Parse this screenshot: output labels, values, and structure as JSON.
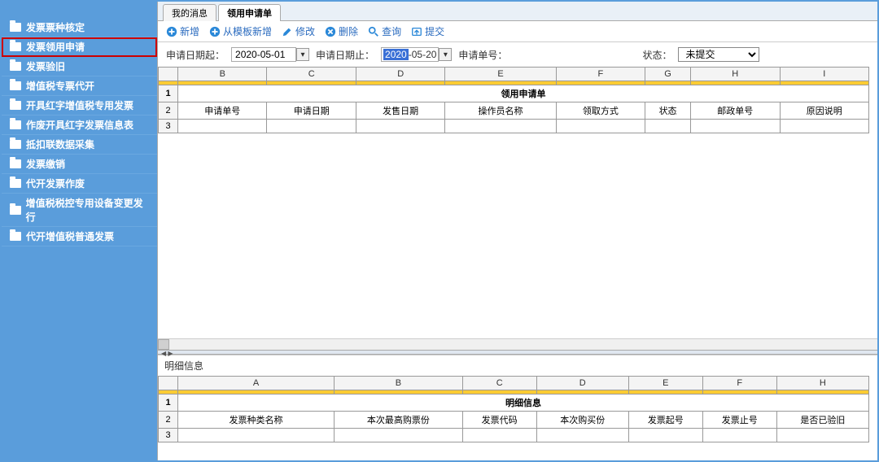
{
  "sidebar": {
    "items": [
      {
        "label": "发票票种核定"
      },
      {
        "label": "发票领用申请",
        "highlighted": true
      },
      {
        "label": "发票验旧"
      },
      {
        "label": "增值税专票代开"
      },
      {
        "label": "开具红字增值税专用发票"
      },
      {
        "label": "作废开具红字发票信息表"
      },
      {
        "label": "抵扣联数据采集"
      },
      {
        "label": "发票缴销"
      },
      {
        "label": "代开发票作废"
      },
      {
        "label": "增值税税控专用设备变更发行"
      },
      {
        "label": "代开增值税普通发票"
      }
    ]
  },
  "tabs": [
    {
      "label": "我的消息",
      "active": false
    },
    {
      "label": "领用申请单",
      "active": true
    }
  ],
  "toolbar": {
    "new": "新增",
    "newFromTpl": "从模板新增",
    "modify": "修改",
    "delete": "删除",
    "query": "查询",
    "submit": "提交"
  },
  "filters": {
    "dateFromLabel": "申请日期起：",
    "dateFrom": "2020-05-01",
    "dateToLabel": "申请日期止：",
    "dateToPrefix": "2020",
    "dateToSuffix": "-05-20",
    "orderLabel": "申请单号：",
    "orderValue": "",
    "stateLabel": "状态：",
    "stateValue": "未提交"
  },
  "mainGrid": {
    "cols": [
      "",
      "B",
      "C",
      "D",
      "E",
      "F",
      "G",
      "H",
      "I"
    ],
    "titleRow": "领用申请单",
    "headers": [
      "申请单号",
      "申请日期",
      "发售日期",
      "操作员名称",
      "领取方式",
      "状态",
      "邮政单号",
      "原因说明"
    ],
    "rows": [
      1,
      2,
      3
    ]
  },
  "detail": {
    "label": "明细信息",
    "cols": [
      "",
      "A",
      "B",
      "C",
      "D",
      "E",
      "F",
      "H"
    ],
    "titleRow": "明细信息",
    "headers": [
      "发票种类名称",
      "本次最高购票份",
      "发票代码",
      "本次购买份",
      "发票起号",
      "发票止号",
      "是否已验旧"
    ],
    "rows": [
      1,
      2,
      3
    ]
  }
}
